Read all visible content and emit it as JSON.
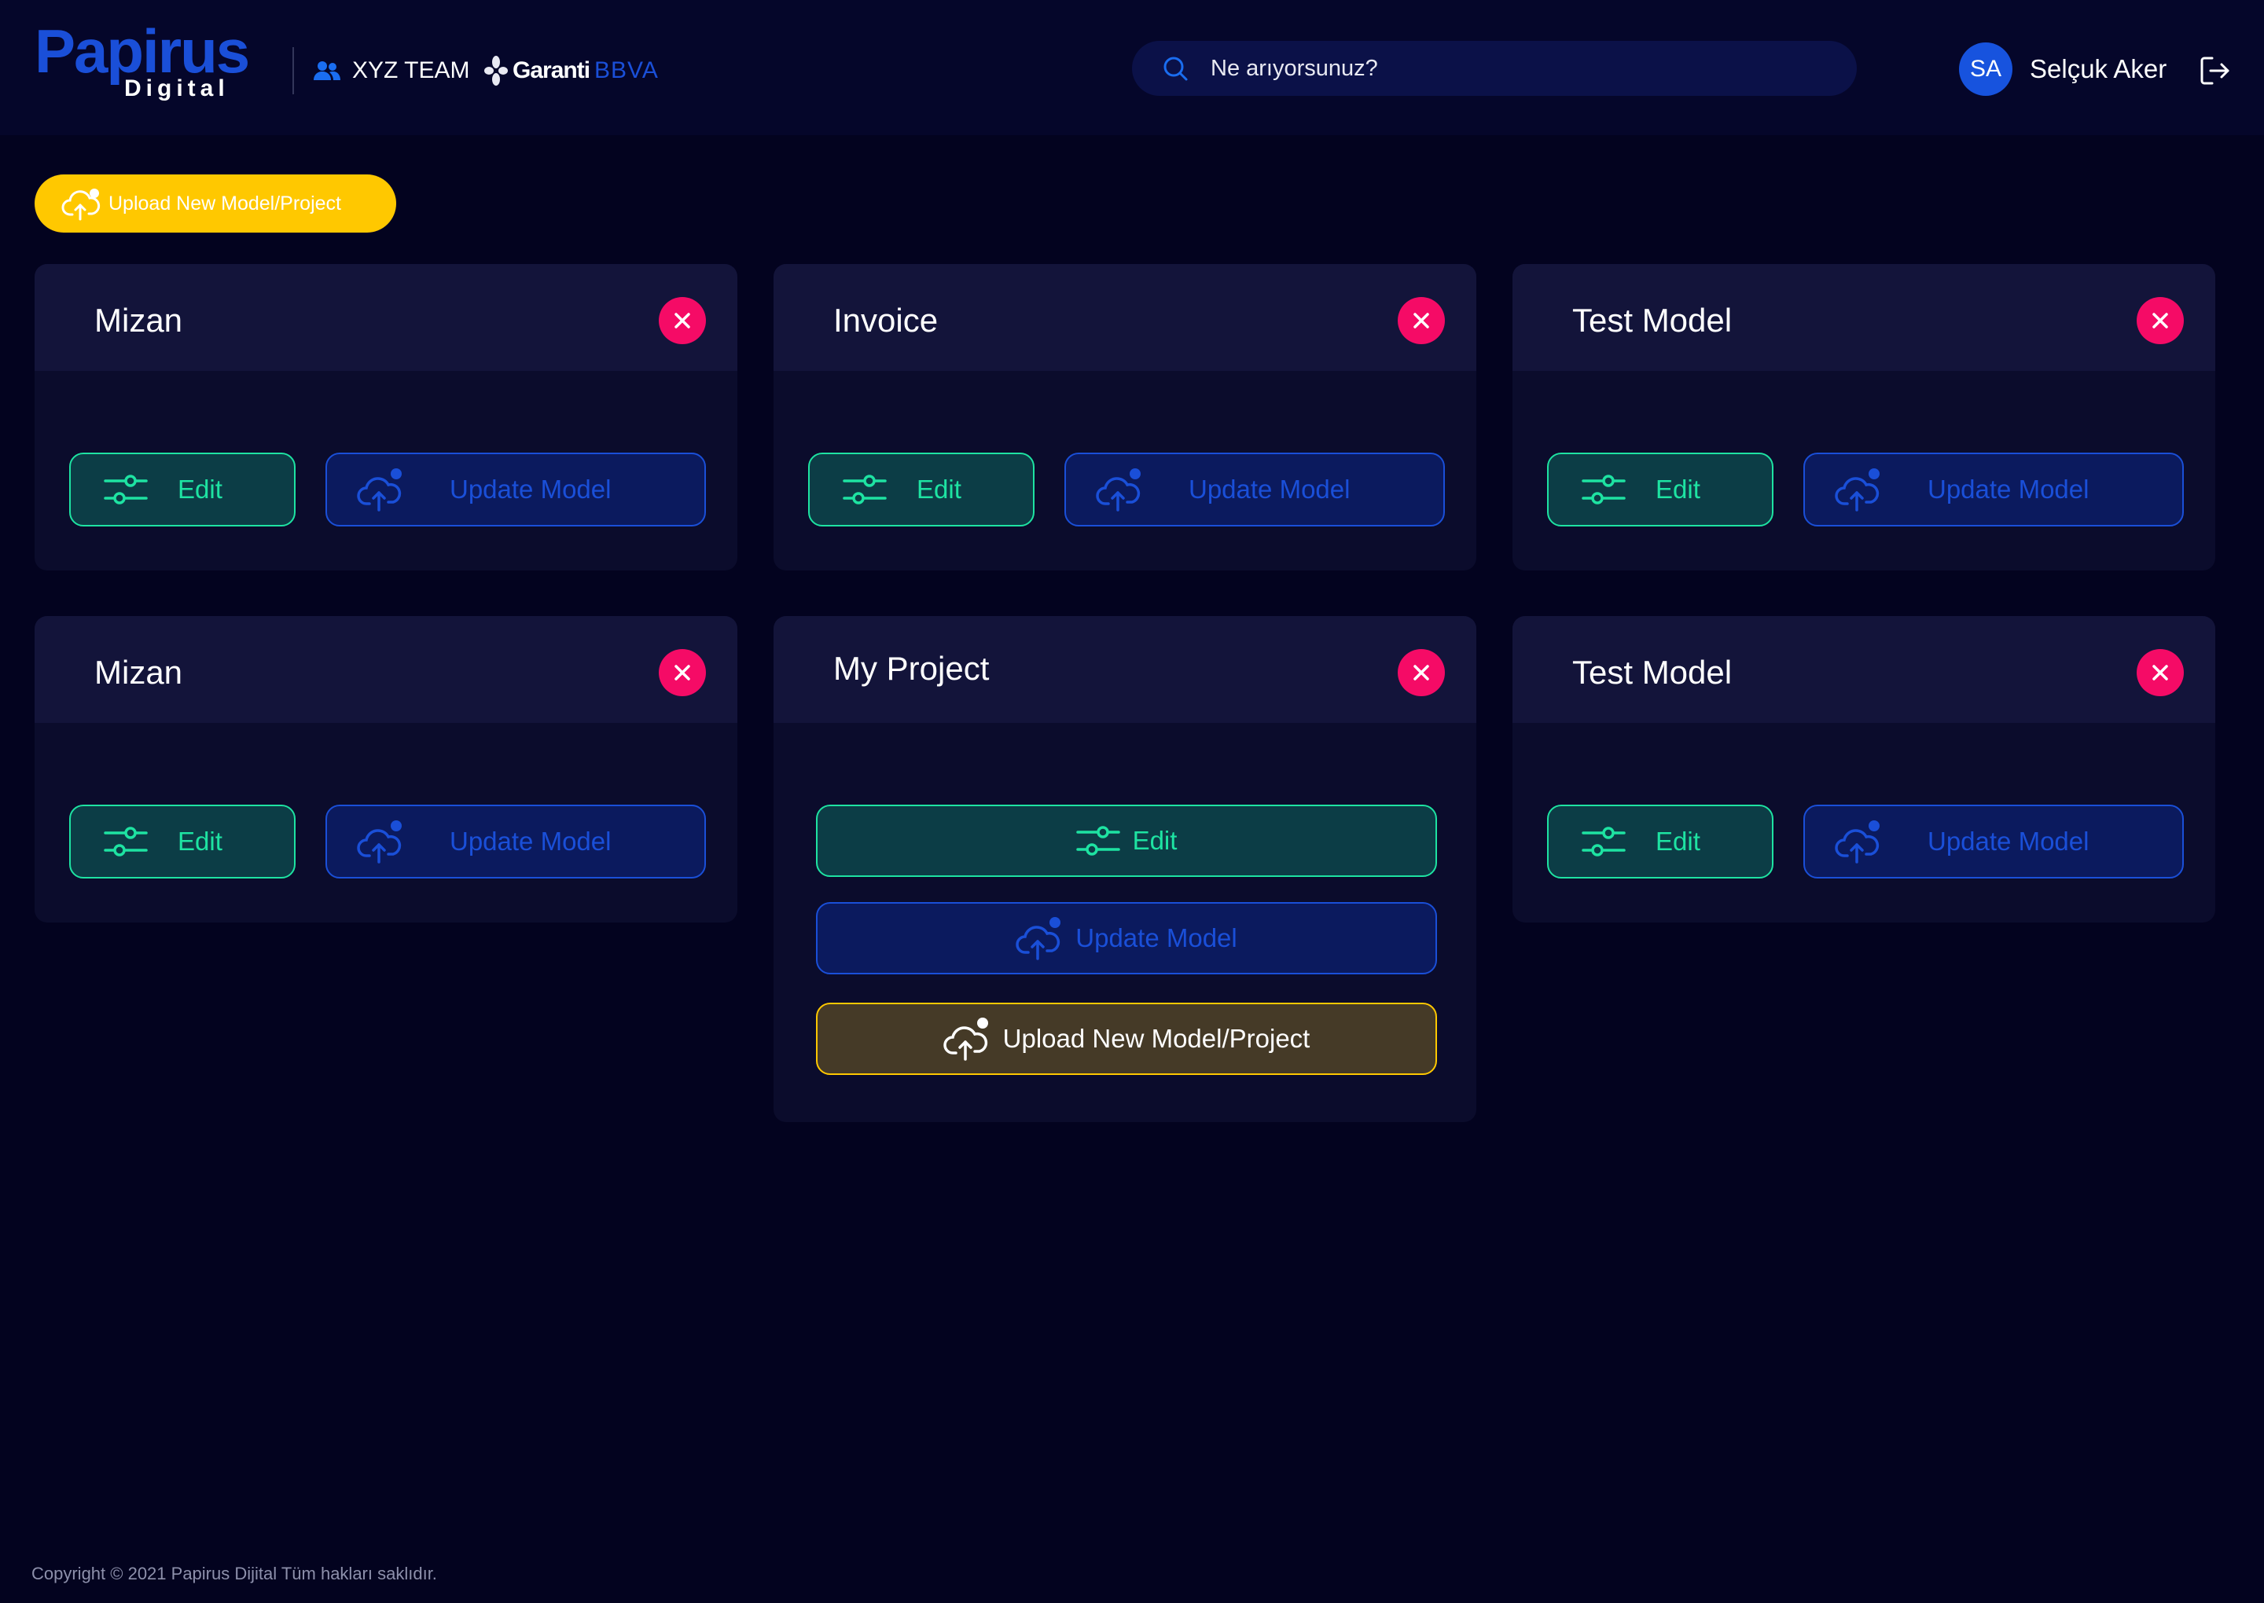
{
  "header": {
    "logo": {
      "main": "Papirus",
      "sub": "Digital"
    },
    "team": {
      "label": "XYZ TEAM",
      "icon": "users-icon"
    },
    "bank": {
      "part1": "Garanti",
      "part2": "BBVA"
    },
    "search": {
      "placeholder": "Ne arıyorsunuz?"
    },
    "user": {
      "initials": "SA",
      "name": "Selçuk Aker"
    }
  },
  "toolbar": {
    "upload_label": "Upload New Model/Project"
  },
  "cards": [
    {
      "title": "Mizan",
      "edit_label": "Edit",
      "update_label": "Update Model"
    },
    {
      "title": "Invoice",
      "edit_label": "Edit",
      "update_label": "Update Model"
    },
    {
      "title": "Test Model",
      "edit_label": "Edit",
      "update_label": "Update Model"
    },
    {
      "title": "Mizan",
      "edit_label": "Edit",
      "update_label": "Update Model"
    },
    {
      "title": "My Project",
      "edit_label": "Edit",
      "update_label": "Update Model",
      "upload_label": "Upload New Model/Project"
    },
    {
      "title": "Test Model",
      "edit_label": "Edit",
      "update_label": "Update Model"
    }
  ],
  "footer": {
    "copyright": "Copyright © 2021 Papirus Dijital Tüm hakları saklıdır."
  },
  "colors": {
    "background": "#03031f",
    "accent_green": "#1ee3a2",
    "accent_blue": "#1a4fd8",
    "accent_yellow": "#ffc800",
    "close_red": "#f50b66"
  }
}
